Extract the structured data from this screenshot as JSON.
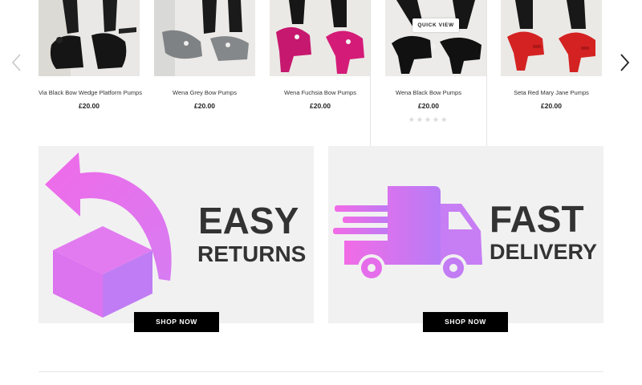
{
  "carousel": {
    "products": [
      {
        "name": "Via Black Bow Wedge Platform Pumps",
        "price": "£20.00"
      },
      {
        "name": "Wena Grey Bow Pumps",
        "price": "£20.00"
      },
      {
        "name": "Wena Fuchsia Bow Pumps",
        "price": "£20.00"
      },
      {
        "name": "Wena Black Bow Pumps",
        "price": "£20.00",
        "quick_view": "QUICK VIEW",
        "stars": "★★★★★",
        "rating": 0
      },
      {
        "name": "Seta Red Mary Jane Pumps",
        "price": "£20.00"
      }
    ],
    "prev_icon": "chevron-left-icon",
    "next_icon": "chevron-right-icon"
  },
  "banners": {
    "returns": {
      "line1": "EASY",
      "line2": "RETURNS",
      "button": "SHOP NOW",
      "icon": "return-box-icon"
    },
    "delivery": {
      "line1": "FAST",
      "line2": "DELIVERY",
      "button": "SHOP NOW",
      "icon": "delivery-truck-icon"
    }
  },
  "colors": {
    "accent_pink": "#f06ee8",
    "accent_purple": "#c678f4",
    "banner_text": "#333333",
    "button_bg": "#000000"
  }
}
